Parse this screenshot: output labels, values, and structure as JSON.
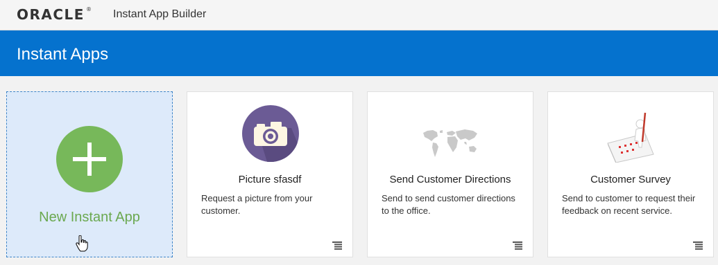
{
  "header": {
    "logo_text": "ORACLE",
    "logo_mark": "®",
    "app_title": "Instant App Builder"
  },
  "banner": {
    "title": "Instant Apps"
  },
  "colors": {
    "banner": "#0572ce",
    "new_card_bg": "#ddeafa",
    "plus_green": "#77b85a",
    "camera_purple": "#6b5b95"
  },
  "new_card": {
    "label": "New Instant App",
    "icon": "plus-icon"
  },
  "cards": [
    {
      "title": "Picture sfasdf",
      "description": "Request a picture from your customer.",
      "icon": "camera-icon"
    },
    {
      "title": "Send Customer Directions",
      "description": "Send to send customer directions to the office.",
      "icon": "world-map-icon"
    },
    {
      "title": "Customer Survey",
      "description": "Send to customer to request their feedback on recent service.",
      "icon": "survey-icon"
    }
  ]
}
